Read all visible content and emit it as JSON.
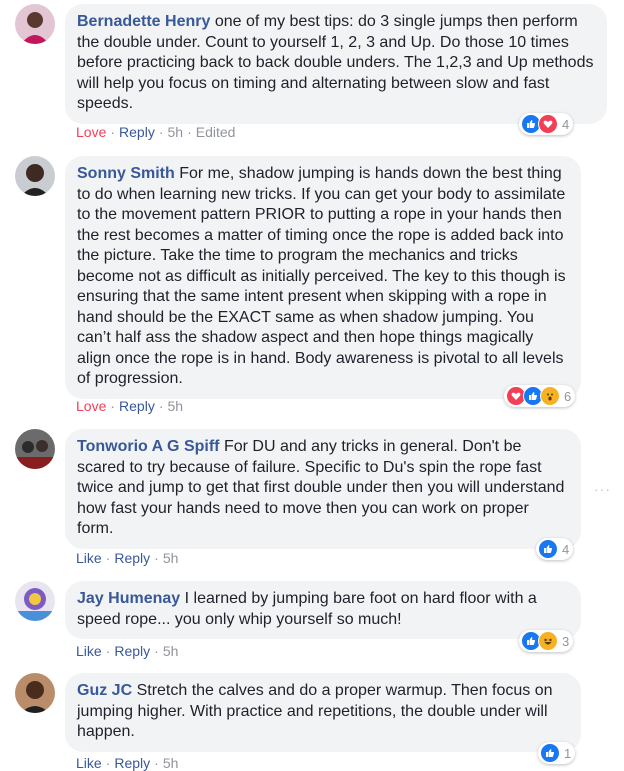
{
  "comments": [
    {
      "author": "Bernadette Henry",
      "text": " one of my best tips: do 3 single jumps then perform the double under. Count to yourself 1, 2, 3 and Up. Do those 10 times before practicing back to back double unders. The 1,2,3 and Up methods will help you focus on timing and alternating between slow and fast speeds.",
      "action": "Love",
      "reply": "Reply",
      "time": "5h",
      "edited": "Edited",
      "reactions": [
        "like-icon",
        "love-icon"
      ],
      "reaction_count": "4"
    },
    {
      "author": "Sonny Smith",
      "text": " For me, shadow jumping is hands down the best thing to do when learning new tricks. If you can get your body to assimilate to the movement pattern PRIOR to putting a rope in your hands then the rest becomes a matter of timing once the rope is added back into the picture. Take the time to program the mechanics and tricks become not as difficult as initially perceived. The key to this though is ensuring that the same intent present when skipping with a rope in hand should be the EXACT same as when shadow jumping. You can’t half ass the shadow aspect and then hope things magically align once the rope is in hand. Body awareness is pivotal to all levels of progression.",
      "action": "Love",
      "reply": "Reply",
      "time": "5h",
      "reactions": [
        "love-icon",
        "like-icon",
        "wow-icon"
      ],
      "reaction_count": "6"
    },
    {
      "author": "Tonworio A G Spiff",
      "text": " For DU and any tricks in general. Don't be scared to try because of failure. Specific to Du's spin the rope fast twice and jump to get that first double under then you will understand how fast your hands need to move then you can work on proper form.",
      "action": "Like",
      "reply": "Reply",
      "time": "5h",
      "reactions": [
        "like-icon"
      ],
      "reaction_count": "4"
    },
    {
      "author": "Jay Humenay",
      "text": " I learned by jumping bare foot on hard floor with a speed rope... you only whip yourself so much!",
      "action": "Like",
      "reply": "Reply",
      "time": "5h",
      "reactions": [
        "like-icon",
        "haha-icon"
      ],
      "reaction_count": "3"
    },
    {
      "author": "Guz JC",
      "text": " Stretch the calves and do a proper warmup. Then focus on jumping higher. With practice and repetitions, the double under will happen.",
      "action": "Like",
      "reply": "Reply",
      "time": "5h",
      "reactions": [
        "like-icon"
      ],
      "reaction_count": "1"
    }
  ],
  "more_options": "···",
  "colors": {
    "author": "#385898",
    "bubble": "#f2f3f5",
    "love": "#f33e58",
    "like": "#1877f2",
    "meta": "#90949c"
  }
}
